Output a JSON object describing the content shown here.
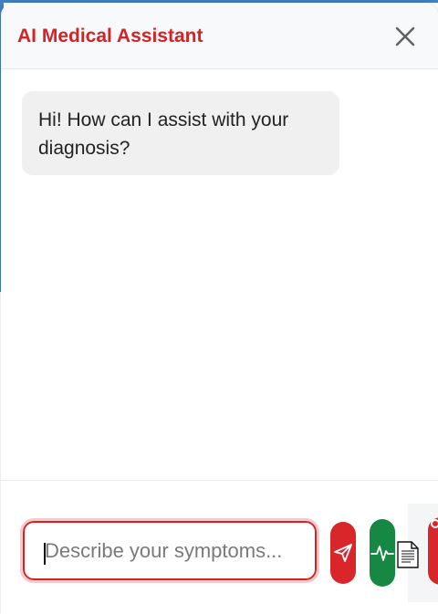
{
  "header": {
    "title": "AI Medical Assistant",
    "close_icon": "close-icon"
  },
  "messages": [
    {
      "sender": "assistant",
      "text": "Hi! How can I assist with your diagnosis?"
    }
  ],
  "composer": {
    "placeholder": "Describe your symptoms...",
    "value": "",
    "send_icon": "send-icon",
    "vitals_icon": "pulse-icon",
    "document_icon": "document-icon"
  },
  "colors": {
    "brand_red": "#d32327",
    "header_bg": "#f8f9fa",
    "bubble_bg": "#f0f0f0",
    "vitals_green": "#178744",
    "page_accent_blue": "#3f7fc2"
  }
}
